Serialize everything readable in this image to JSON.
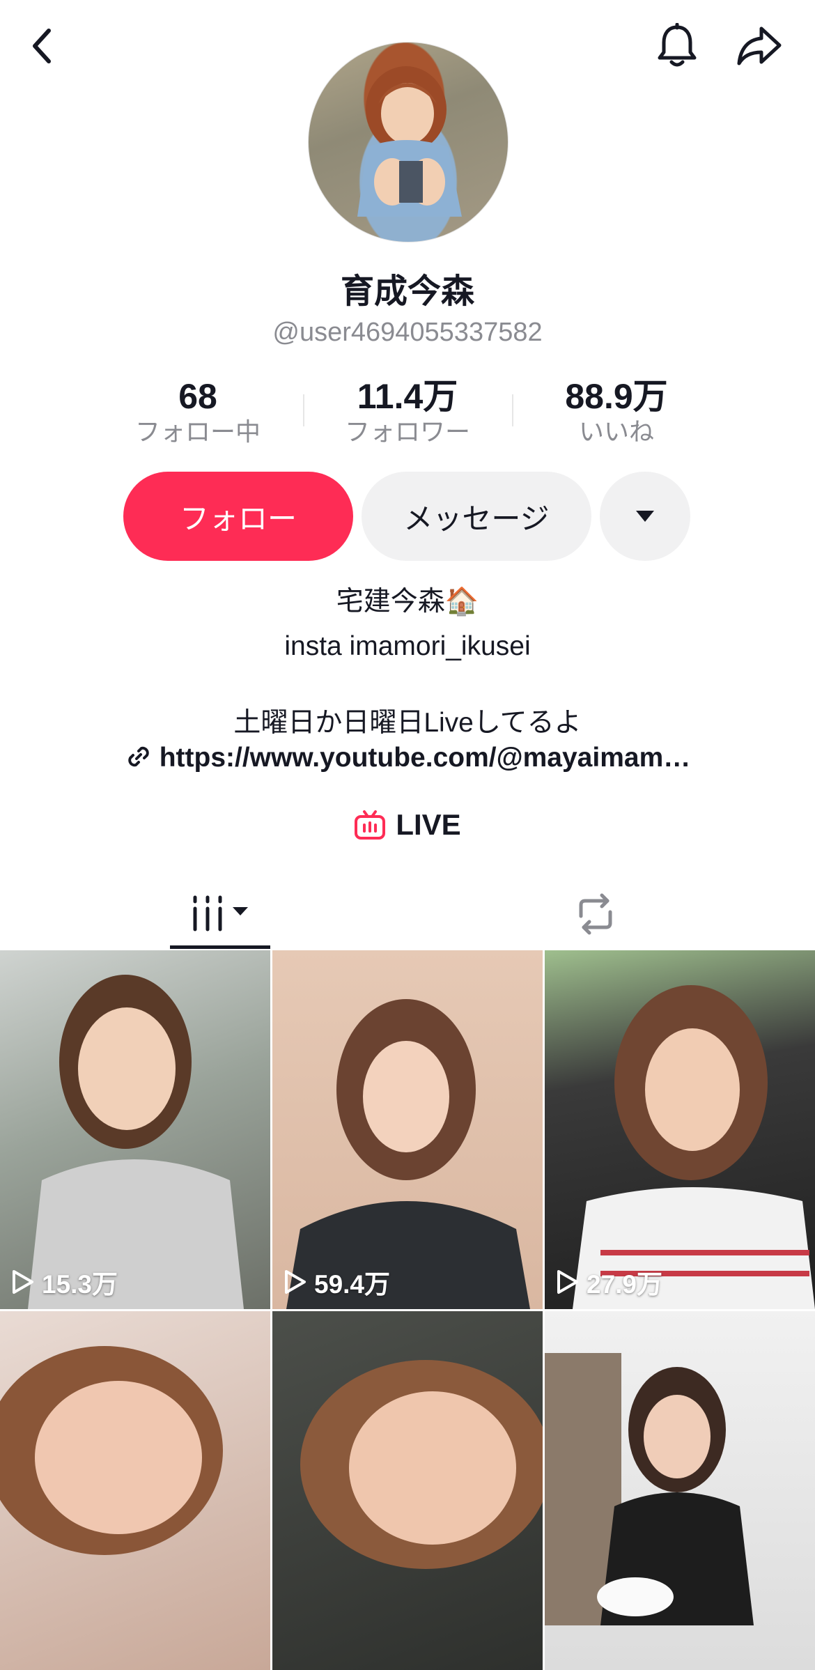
{
  "header": {
    "back_icon": "chevron-left-icon",
    "bell_icon": "bell-icon",
    "share_icon": "share-arrow-icon"
  },
  "profile": {
    "display_name": "育成今森",
    "username": "@user4694055337582"
  },
  "stats": [
    {
      "value": "68",
      "label": "フォロー中"
    },
    {
      "value": "11.4万",
      "label": "フォロワー"
    },
    {
      "value": "88.9万",
      "label": "いいね"
    }
  ],
  "actions": {
    "follow_label": "フォロー",
    "message_label": "メッセージ",
    "more_icon": "caret-down-icon"
  },
  "bio": {
    "line1": "宅建今森🏠",
    "line2": "insta  imamori_ikusei",
    "line3": "土曜日か日曜日Liveしてるよ",
    "link": "https://www.youtube.com/@mayaimam…",
    "link_icon": "link-icon",
    "live_label": "LIVE",
    "live_icon": "tv-icon"
  },
  "tabs": [
    {
      "name": "videos",
      "icon": "grid-icon",
      "selected": true
    },
    {
      "name": "reposts",
      "icon": "repost-icon",
      "selected": false
    }
  ],
  "videos": [
    {
      "views": "15.3万"
    },
    {
      "views": "59.4万"
    },
    {
      "views": "27.9万"
    },
    {
      "views": ""
    },
    {
      "views": ""
    },
    {
      "views": ""
    }
  ],
  "colors": {
    "accent": "#fe2c55",
    "text": "#161823",
    "secondary": "#8a8b91",
    "button_bg": "#f1f1f2"
  }
}
